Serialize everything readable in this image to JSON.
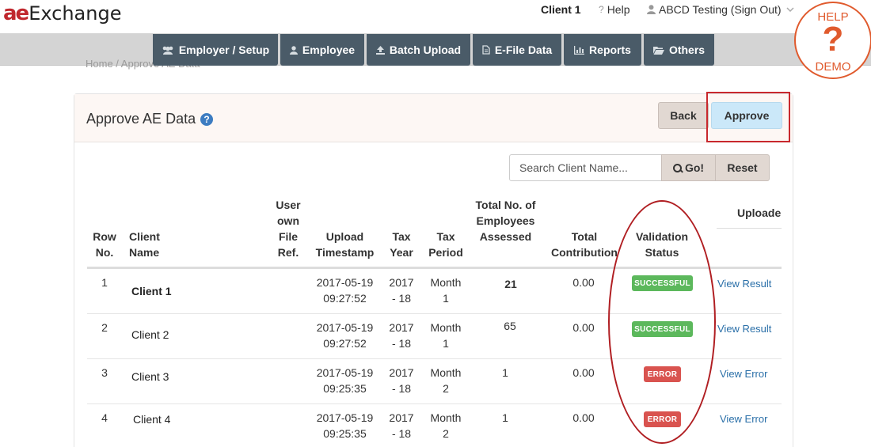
{
  "header": {
    "logo_ae": "ae",
    "logo_exchange": "Exchange",
    "client": "Client 1",
    "help": "Help",
    "user": "ABCD Testing (Sign Out)"
  },
  "help_demo": {
    "top": "HELP",
    "mark": "?",
    "bottom": "DEMO"
  },
  "nav": [
    {
      "label": "Employer / Setup",
      "icon": "users-icon"
    },
    {
      "label": "Employee",
      "icon": "user-icon"
    },
    {
      "label": "Batch Upload",
      "icon": "upload-icon"
    },
    {
      "label": "E-File Data",
      "icon": "file-icon"
    },
    {
      "label": "Reports",
      "icon": "bar-chart-icon"
    },
    {
      "label": "Others",
      "icon": "folder-icon"
    }
  ],
  "breadcrumb": "Home  /  Approve AE Data",
  "panel": {
    "title": "Approve AE Data",
    "back_label": "Back",
    "approve_label": "Approve"
  },
  "search": {
    "placeholder": "Search Client Name...",
    "go_label": "Go!",
    "reset_label": "Reset"
  },
  "table": {
    "headers": {
      "row_no": "Row No.",
      "client_name": "Client Name",
      "file_ref": "User own File Ref.",
      "upload_timestamp": "Upload Timestamp",
      "tax_year": "Tax Year",
      "tax_period": "Tax Period",
      "total_employees": "Total No. of Employees Assessed",
      "total_contribution": "Total Contribution",
      "validation_status": "Validation Status",
      "uploaded": "Uploade"
    },
    "rows": [
      {
        "no": "1",
        "client": "Client  1",
        "date": "2017-05-19",
        "time": "09:27:52",
        "year_a": "2017",
        "year_b": "- 18",
        "period_a": "Month",
        "period_b": "1",
        "employees": "21",
        "contribution": "0.00",
        "status": "SUCCESSFUL",
        "action": "View Result"
      },
      {
        "no": "2",
        "client": "Client   2",
        "date": "2017-05-19",
        "time": "09:27:52",
        "year_a": "2017",
        "year_b": "- 18",
        "period_a": "Month",
        "period_b": "1",
        "employees": "65",
        "contribution": "0.00",
        "status": "SUCCESSFUL",
        "action": "View Result"
      },
      {
        "no": "3",
        "client": "Client   3",
        "date": "2017-05-19",
        "time": "09:25:35",
        "year_a": "2017",
        "year_b": "- 18",
        "period_a": "Month",
        "period_b": "2",
        "employees": "1",
        "contribution": "0.00",
        "status": "ERROR",
        "action": "View Error"
      },
      {
        "no": "4",
        "client": "Client   4",
        "date": "2017-05-19",
        "time": "09:25:35",
        "year_a": "2017",
        "year_b": "- 18",
        "period_a": "Month",
        "period_b": "2",
        "employees": "1",
        "contribution": "0.00",
        "status": "ERROR",
        "action": "View Error"
      }
    ]
  },
  "colors": {
    "nav_bg": "#4a5b68",
    "success": "#5cb85c",
    "error": "#d9534f",
    "highlight_red": "#c8282d",
    "help_orange": "#e05a2d",
    "link": "#2a6fa8"
  }
}
